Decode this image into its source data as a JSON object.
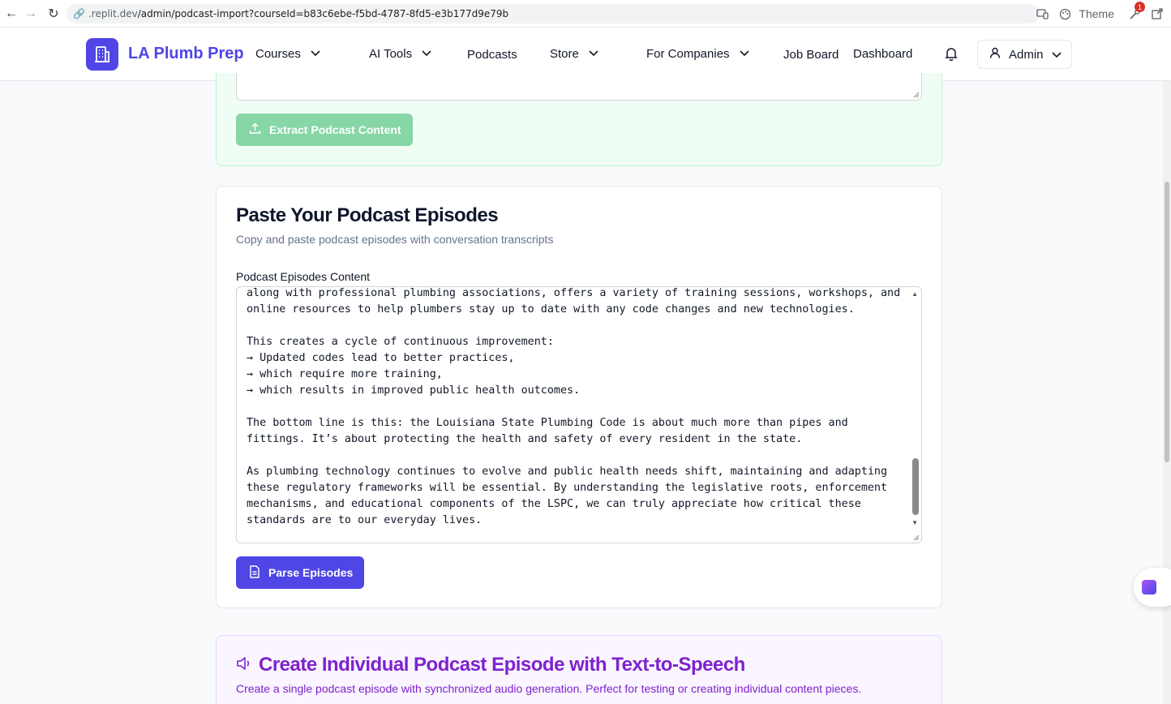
{
  "browser": {
    "url_host": ".replit.dev",
    "url_path": "/admin/podcast-import?courseId=b83c6ebe-f5bd-4787-8fd5-e3b177d9e79b",
    "theme_label": "Theme",
    "badge_count": "1"
  },
  "header": {
    "brand": "LA Plumb Prep",
    "nav": {
      "courses": "Courses",
      "ai_tools": "AI Tools",
      "podcasts": "Podcasts",
      "store": "Store",
      "for_companies": "For Companies",
      "job_board": "Job Board",
      "dashboard": "Dashboard"
    },
    "user_menu": "Admin"
  },
  "extract_card": {
    "button_label": "Extract Podcast Content"
  },
  "paste_card": {
    "title": "Paste Your Podcast Episodes",
    "subtitle": "Copy and paste podcast episodes with conversation transcripts",
    "field_label": "Podcast Episodes Content",
    "content": "along with professional plumbing associations, offers a variety of training sessions, workshops, and online resources to help plumbers stay up to date with any code changes and new technologies.\n\nThis creates a cycle of continuous improvement:\n→ Updated codes lead to better practices,\n→ which require more training,\n→ which results in improved public health outcomes.\n\nThe bottom line is this: the Louisiana State Plumbing Code is about much more than pipes and fittings. It’s about protecting the health and safety of every resident in the state.\n\nAs plumbing technology continues to evolve and public health needs shift, maintaining and adapting these regulatory frameworks will be essential. By understanding the legislative roots, enforcement mechanisms, and educational components of the LSPC, we can truly appreciate how critical these standards are to our everyday lives.",
    "button_label": "Parse Episodes"
  },
  "tts_card": {
    "title": "Create Individual Podcast Episode with Text-to-Speech",
    "subtitle": "Create a single podcast episode with synchronized audio generation. Perfect for testing or creating individual content pieces."
  },
  "colors": {
    "primary": "#4f46e5",
    "success_light": "#86d6a6",
    "purple": "#7e22ce"
  }
}
